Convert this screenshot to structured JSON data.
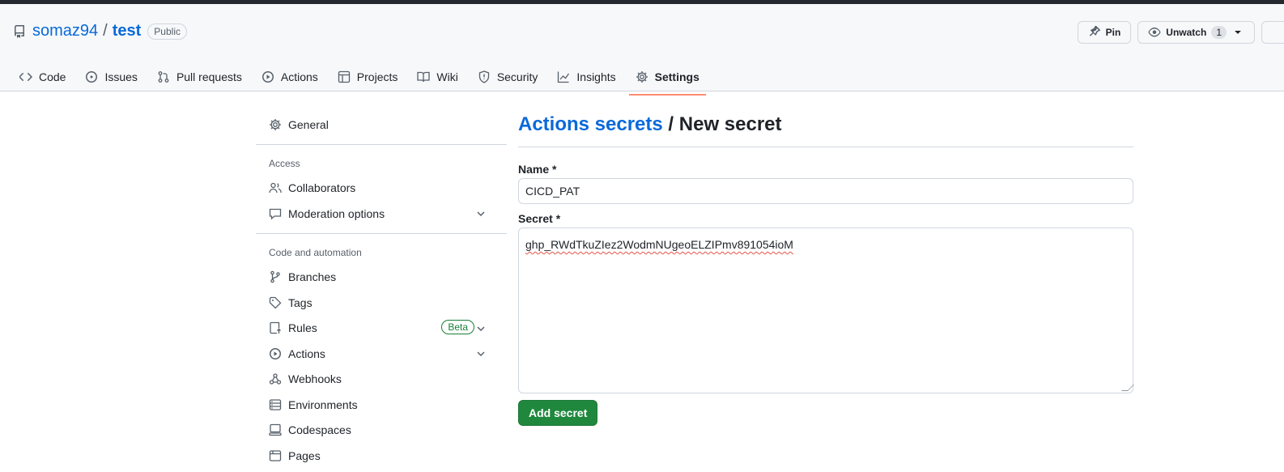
{
  "header": {
    "owner": "somaz94",
    "separator": "/",
    "repo": "test",
    "visibility": "Public",
    "pin_label": "Pin",
    "unwatch_label": "Unwatch",
    "watch_count": "1"
  },
  "nav": {
    "tabs": [
      {
        "label": "Code",
        "icon": "code-icon"
      },
      {
        "label": "Issues",
        "icon": "issue-icon"
      },
      {
        "label": "Pull requests",
        "icon": "pull-request-icon"
      },
      {
        "label": "Actions",
        "icon": "play-icon"
      },
      {
        "label": "Projects",
        "icon": "table-icon"
      },
      {
        "label": "Wiki",
        "icon": "book-icon"
      },
      {
        "label": "Security",
        "icon": "shield-icon"
      },
      {
        "label": "Insights",
        "icon": "graph-icon"
      },
      {
        "label": "Settings",
        "icon": "gear-icon",
        "active": true
      }
    ]
  },
  "sidebar": {
    "general": "General",
    "access_heading": "Access",
    "collaborators": "Collaborators",
    "moderation": "Moderation options",
    "code_heading": "Code and automation",
    "branches": "Branches",
    "tags": "Tags",
    "rules": "Rules",
    "rules_badge": "Beta",
    "actions": "Actions",
    "webhooks": "Webhooks",
    "environments": "Environments",
    "codespaces": "Codespaces",
    "pages": "Pages"
  },
  "main": {
    "breadcrumb_link": "Actions secrets",
    "breadcrumb_sep": " / ",
    "title": "New secret",
    "name_label": "Name *",
    "name_value": "CICD_PAT",
    "secret_label": "Secret *",
    "secret_value": "ghp_RWdTkuZIez2WodmNUgeoELZIPmv891054ioM",
    "submit_label": "Add secret"
  },
  "colors": {
    "link": "#0969da",
    "primary_button": "#1f883d",
    "active_tab_underline": "#fd8c73",
    "beta_badge": "#1a7f37"
  }
}
